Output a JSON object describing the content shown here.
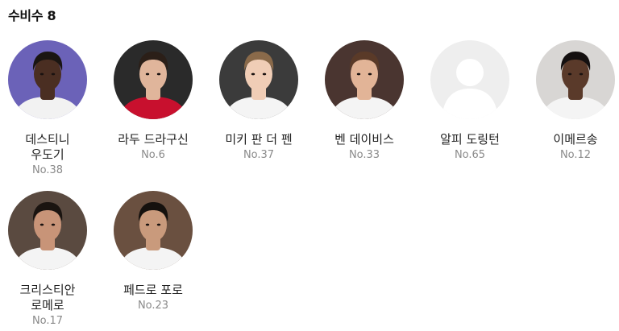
{
  "section": {
    "title": "수비수 8"
  },
  "players": [
    {
      "name": "데스티니 우도기",
      "number": "No.38",
      "icon": "player-photo",
      "bg": "#6b62b8",
      "skin": "#4a2e22",
      "hair": "#1a1512",
      "shirt": "#f2f2f2"
    },
    {
      "name": "라두 드라구신",
      "number": "No.6",
      "icon": "player-photo",
      "bg": "#2a2a2a",
      "skin": "#e0b59b",
      "hair": "#2b1f18",
      "shirt": "#c8102e"
    },
    {
      "name": "미키 판 더 펜",
      "number": "No.37",
      "icon": "player-photo",
      "bg": "#3b3b3b",
      "skin": "#f0cdb6",
      "hair": "#8a6a4a",
      "shirt": "#f4f4f4"
    },
    {
      "name": "벤 데이비스",
      "number": "No.33",
      "icon": "player-photo",
      "bg": "#4a3530",
      "skin": "#e2b497",
      "hair": "#5a3a28",
      "shirt": "#f4f4f4"
    },
    {
      "name": "알피 도링턴",
      "number": "No.65",
      "icon": "default-avatar-icon",
      "bg": "#eeeeee",
      "skin": "#ffffff",
      "hair": "#ffffff",
      "shirt": "#ffffff"
    },
    {
      "name": "이메르송",
      "number": "No.12",
      "icon": "player-photo",
      "bg": "#d8d6d4",
      "skin": "#5a3a2a",
      "hair": "#141010",
      "shirt": "#f4f4f4"
    },
    {
      "name": "크리스티안 로메로",
      "number": "No.17",
      "icon": "player-photo",
      "bg": "#5a4a40",
      "skin": "#c89478",
      "hair": "#1a1410",
      "shirt": "#f4f4f4"
    },
    {
      "name": "페드로 포로",
      "number": "No.23",
      "icon": "player-photo",
      "bg": "#6a5040",
      "skin": "#c99a7c",
      "hair": "#15110e",
      "shirt": "#f4f4f4"
    }
  ]
}
